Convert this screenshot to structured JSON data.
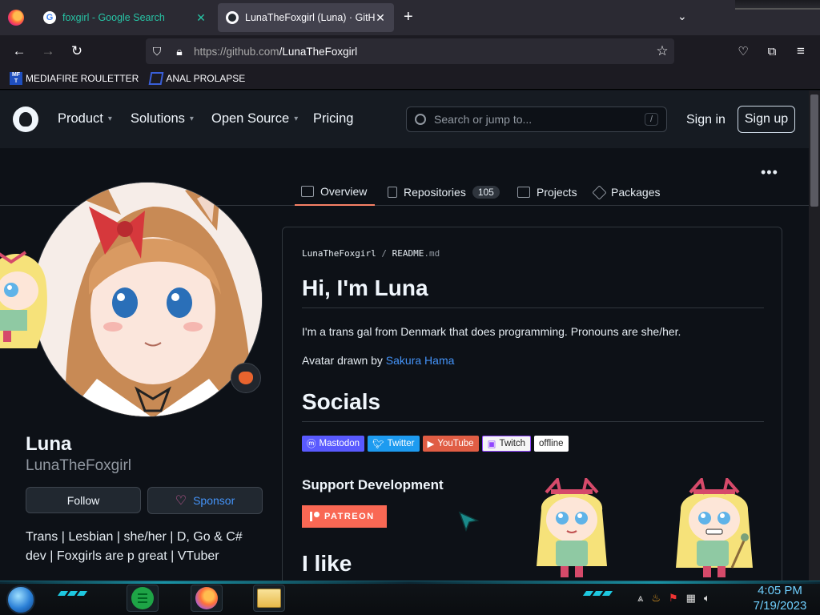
{
  "browser": {
    "tabs": [
      {
        "title": "foxgirl - Google Search",
        "favicon": "google-icon"
      },
      {
        "title": "LunaTheFoxgirl (Luna) · GitHub",
        "favicon": "github-icon"
      }
    ],
    "url_host": "https://github.com",
    "url_path": "/LunaTheFoxgirl",
    "bookmarks": [
      {
        "label": "MEDIAFIRE ROULETTER",
        "icon_text": "MF T"
      },
      {
        "label": "ANAL PROLAPSE",
        "icon_text": ""
      }
    ]
  },
  "github_header": {
    "menu": [
      "Product",
      "Solutions",
      "Open Source",
      "Pricing"
    ],
    "search_placeholder": "Search or jump to...",
    "search_shortcut": "/",
    "sign_in": "Sign in",
    "sign_up": "Sign up"
  },
  "profile_tabs": {
    "overview": "Overview",
    "repositories": "Repositories",
    "repositories_count": "105",
    "projects": "Projects",
    "packages": "Packages"
  },
  "profile": {
    "name": "Luna",
    "login": "LunaTheFoxgirl",
    "follow": "Follow",
    "sponsor": "Sponsor",
    "bio": "Trans | Lesbian | she/her | D, Go & C# dev | Foxgirls are p great | VTuber"
  },
  "readme": {
    "crumb_user": "LunaTheFoxgirl",
    "crumb_sep": "/",
    "crumb_file": "README",
    "crumb_ext": ".md",
    "heading1": "Hi, I'm Luna",
    "intro": "I'm a trans gal from Denmark that does programming. Pronouns are she/her.",
    "avatar_credit_prefix": "Avatar drawn by ",
    "avatar_credit_link": "Sakura Hama",
    "heading2": "Socials",
    "badges": [
      {
        "label": "Mastodon",
        "color": "#595aff"
      },
      {
        "label": "Twitter",
        "color": "#1d9bf0"
      },
      {
        "label": "YouTube",
        "color": "#e05d44"
      },
      {
        "label": "Twitch",
        "color": "#f5f5f5"
      },
      {
        "label": "offline",
        "color": "#ffffff"
      }
    ],
    "support_heading": "Support Development",
    "patreon": "PATREON",
    "heading3": "I like"
  },
  "taskbar": {
    "time": "4:05 PM",
    "date": "7/19/2023"
  }
}
